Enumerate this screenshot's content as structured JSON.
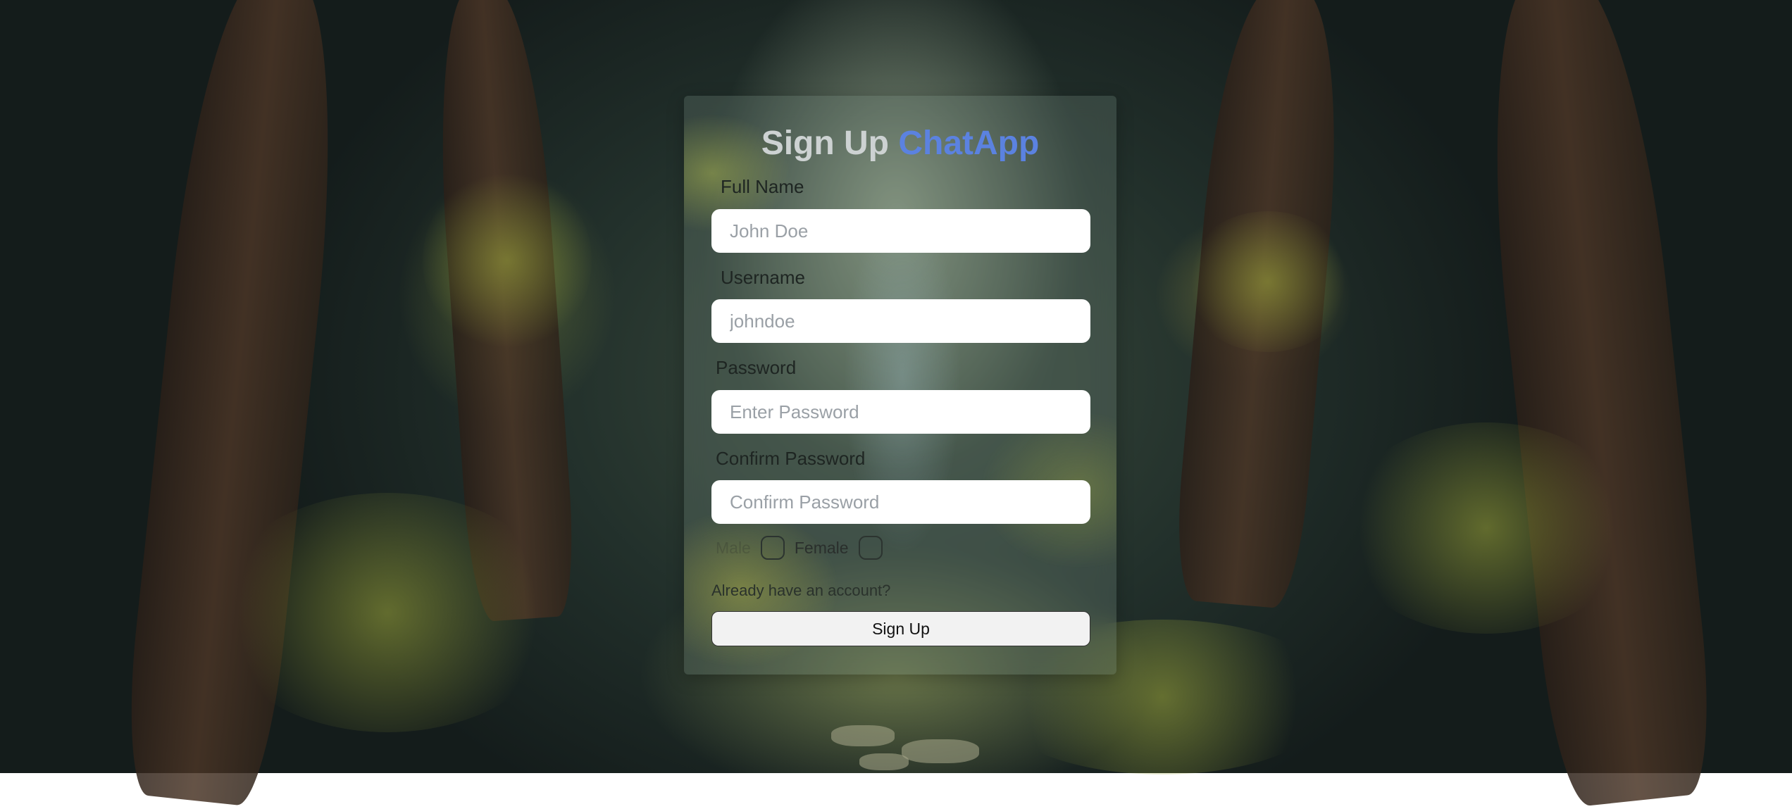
{
  "page": {
    "title_part1": "Sign Up",
    "title_part2": "ChatApp"
  },
  "form": {
    "full_name": {
      "label": "Full Name",
      "placeholder": "John Doe",
      "value": ""
    },
    "username": {
      "label": "Username",
      "placeholder": "johndoe",
      "value": ""
    },
    "password": {
      "label": "Password",
      "placeholder": "Enter Password",
      "value": ""
    },
    "confirm_password": {
      "label": "Confirm Password",
      "placeholder": "Confirm Password",
      "value": ""
    },
    "gender": {
      "male_label": "Male",
      "female_label": "Female",
      "male_checked": false,
      "female_checked": false
    },
    "login_link": "Already have an account?",
    "submit_label": "Sign Up"
  },
  "colors": {
    "title_primary": "#cdd2d2",
    "title_accent": "#5b82e0",
    "input_background": "#ffffff",
    "button_background": "#f2f2f2"
  }
}
